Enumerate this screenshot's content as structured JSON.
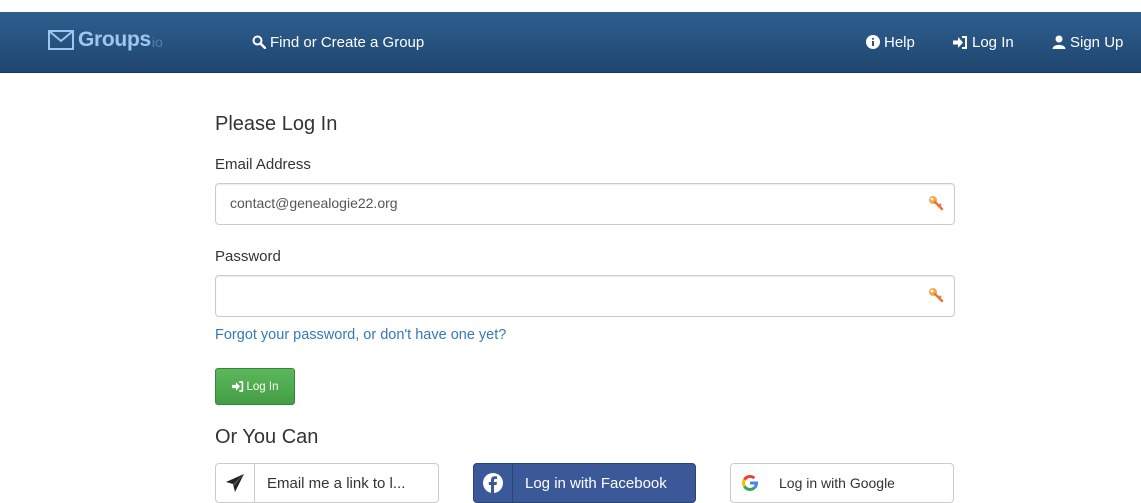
{
  "navbar": {
    "brand": {
      "name": "Groups",
      "suffix": "io",
      "icon": "envelope-icon"
    },
    "find_label": "Find or Create a Group",
    "help_label": "Help",
    "login_label": "Log In",
    "signup_label": "Sign Up",
    "icons": {
      "find": "search-icon",
      "help": "info-icon",
      "login": "sign-in-icon",
      "signup": "user-icon"
    }
  },
  "form": {
    "heading": "Please Log In",
    "email": {
      "label": "Email Address",
      "value": "contact@genealogie22.org",
      "icon": "key-icon"
    },
    "password": {
      "label": "Password",
      "value": "",
      "icon": "key-icon"
    },
    "forgot_link": "Forgot your password, or don't have one yet?",
    "submit_label": "Log In"
  },
  "alternatives": {
    "heading": "Or You Can",
    "email_link_label": "Email me a link to l...",
    "facebook_label": "Log in with Facebook",
    "google_label": "Log in with Google"
  },
  "colors": {
    "navbar": "#2a5682",
    "link": "#337ab7",
    "success": "#5cb85c",
    "facebook": "#3b5998",
    "key": "#f0ad4e"
  }
}
